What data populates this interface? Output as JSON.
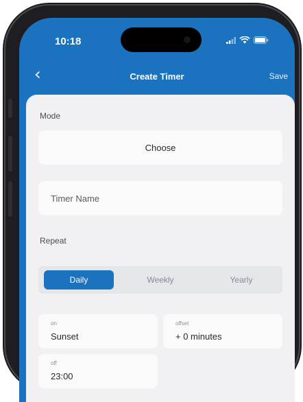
{
  "status_bar": {
    "time": "10:18"
  },
  "nav": {
    "back_icon": "‹",
    "title": "Create Timer",
    "save_label": "Save"
  },
  "mode": {
    "label": "Mode",
    "choose_label": "Choose"
  },
  "timer_name": {
    "placeholder": "Timer Name"
  },
  "repeat": {
    "label": "Repeat",
    "options": [
      "Daily",
      "Weekly",
      "Yearly"
    ],
    "selected": "Daily"
  },
  "fields": {
    "on_label": "on",
    "on_value": "Sunset",
    "offset_label": "offset",
    "offset_value": "+ 0 minutes",
    "off_label": "off",
    "off_value": "23:00"
  },
  "colors": {
    "accent": "#1b73c0",
    "background": "#f1f1f3",
    "card": "#fafafa"
  },
  "icons": [
    "chevron-left-icon",
    "signal-icon",
    "wifi-icon",
    "battery-icon"
  ]
}
